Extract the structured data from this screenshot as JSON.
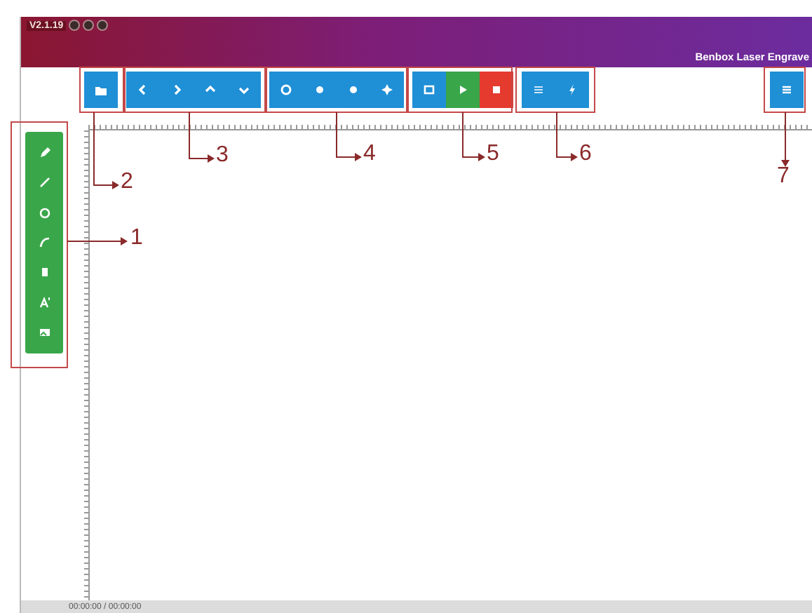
{
  "window": {
    "title": "V2.1.19",
    "app_name": "Benbox Laser Engrave"
  },
  "toolbar": {
    "groups": [
      {
        "buttons": [
          {
            "kind": "folder",
            "color": "#1f8fd6"
          }
        ]
      },
      {
        "buttons": [
          {
            "kind": "left",
            "color": "#1f8fd6"
          },
          {
            "kind": "right",
            "color": "#1f8fd6"
          },
          {
            "kind": "up",
            "color": "#1f8fd6"
          },
          {
            "kind": "down",
            "color": "#1f8fd6"
          }
        ]
      },
      {
        "buttons": [
          {
            "kind": "gear",
            "color": "#1f8fd6"
          },
          {
            "kind": "dot",
            "color": "#1f8fd6"
          },
          {
            "kind": "dot",
            "color": "#1f8fd6"
          },
          {
            "kind": "move",
            "color": "#1f8fd6"
          }
        ]
      },
      {
        "buttons": [
          {
            "kind": "frame",
            "color": "#1f8fd6"
          },
          {
            "kind": "play",
            "color": "#3aa64a"
          },
          {
            "kind": "stop",
            "color": "#e53a2e"
          }
        ]
      },
      {
        "buttons": [
          {
            "kind": "list",
            "color": "#1f8fd6"
          },
          {
            "kind": "bolt",
            "color": "#1f8fd6"
          }
        ]
      },
      {
        "buttons": [
          {
            "kind": "menu",
            "color": "#1f8fd6"
          }
        ]
      }
    ]
  },
  "side_toolbar": {
    "tools": [
      {
        "kind": "pencil"
      },
      {
        "kind": "line"
      },
      {
        "kind": "circle"
      },
      {
        "kind": "curve"
      },
      {
        "kind": "rect"
      },
      {
        "kind": "text"
      },
      {
        "kind": "image"
      }
    ]
  },
  "callouts": [
    {
      "label": "1"
    },
    {
      "label": "2"
    },
    {
      "label": "3"
    },
    {
      "label": "4"
    },
    {
      "label": "5"
    },
    {
      "label": "6"
    },
    {
      "label": "7"
    }
  ],
  "status_bar": {
    "time": "00:00:00 / 00:00:00"
  }
}
